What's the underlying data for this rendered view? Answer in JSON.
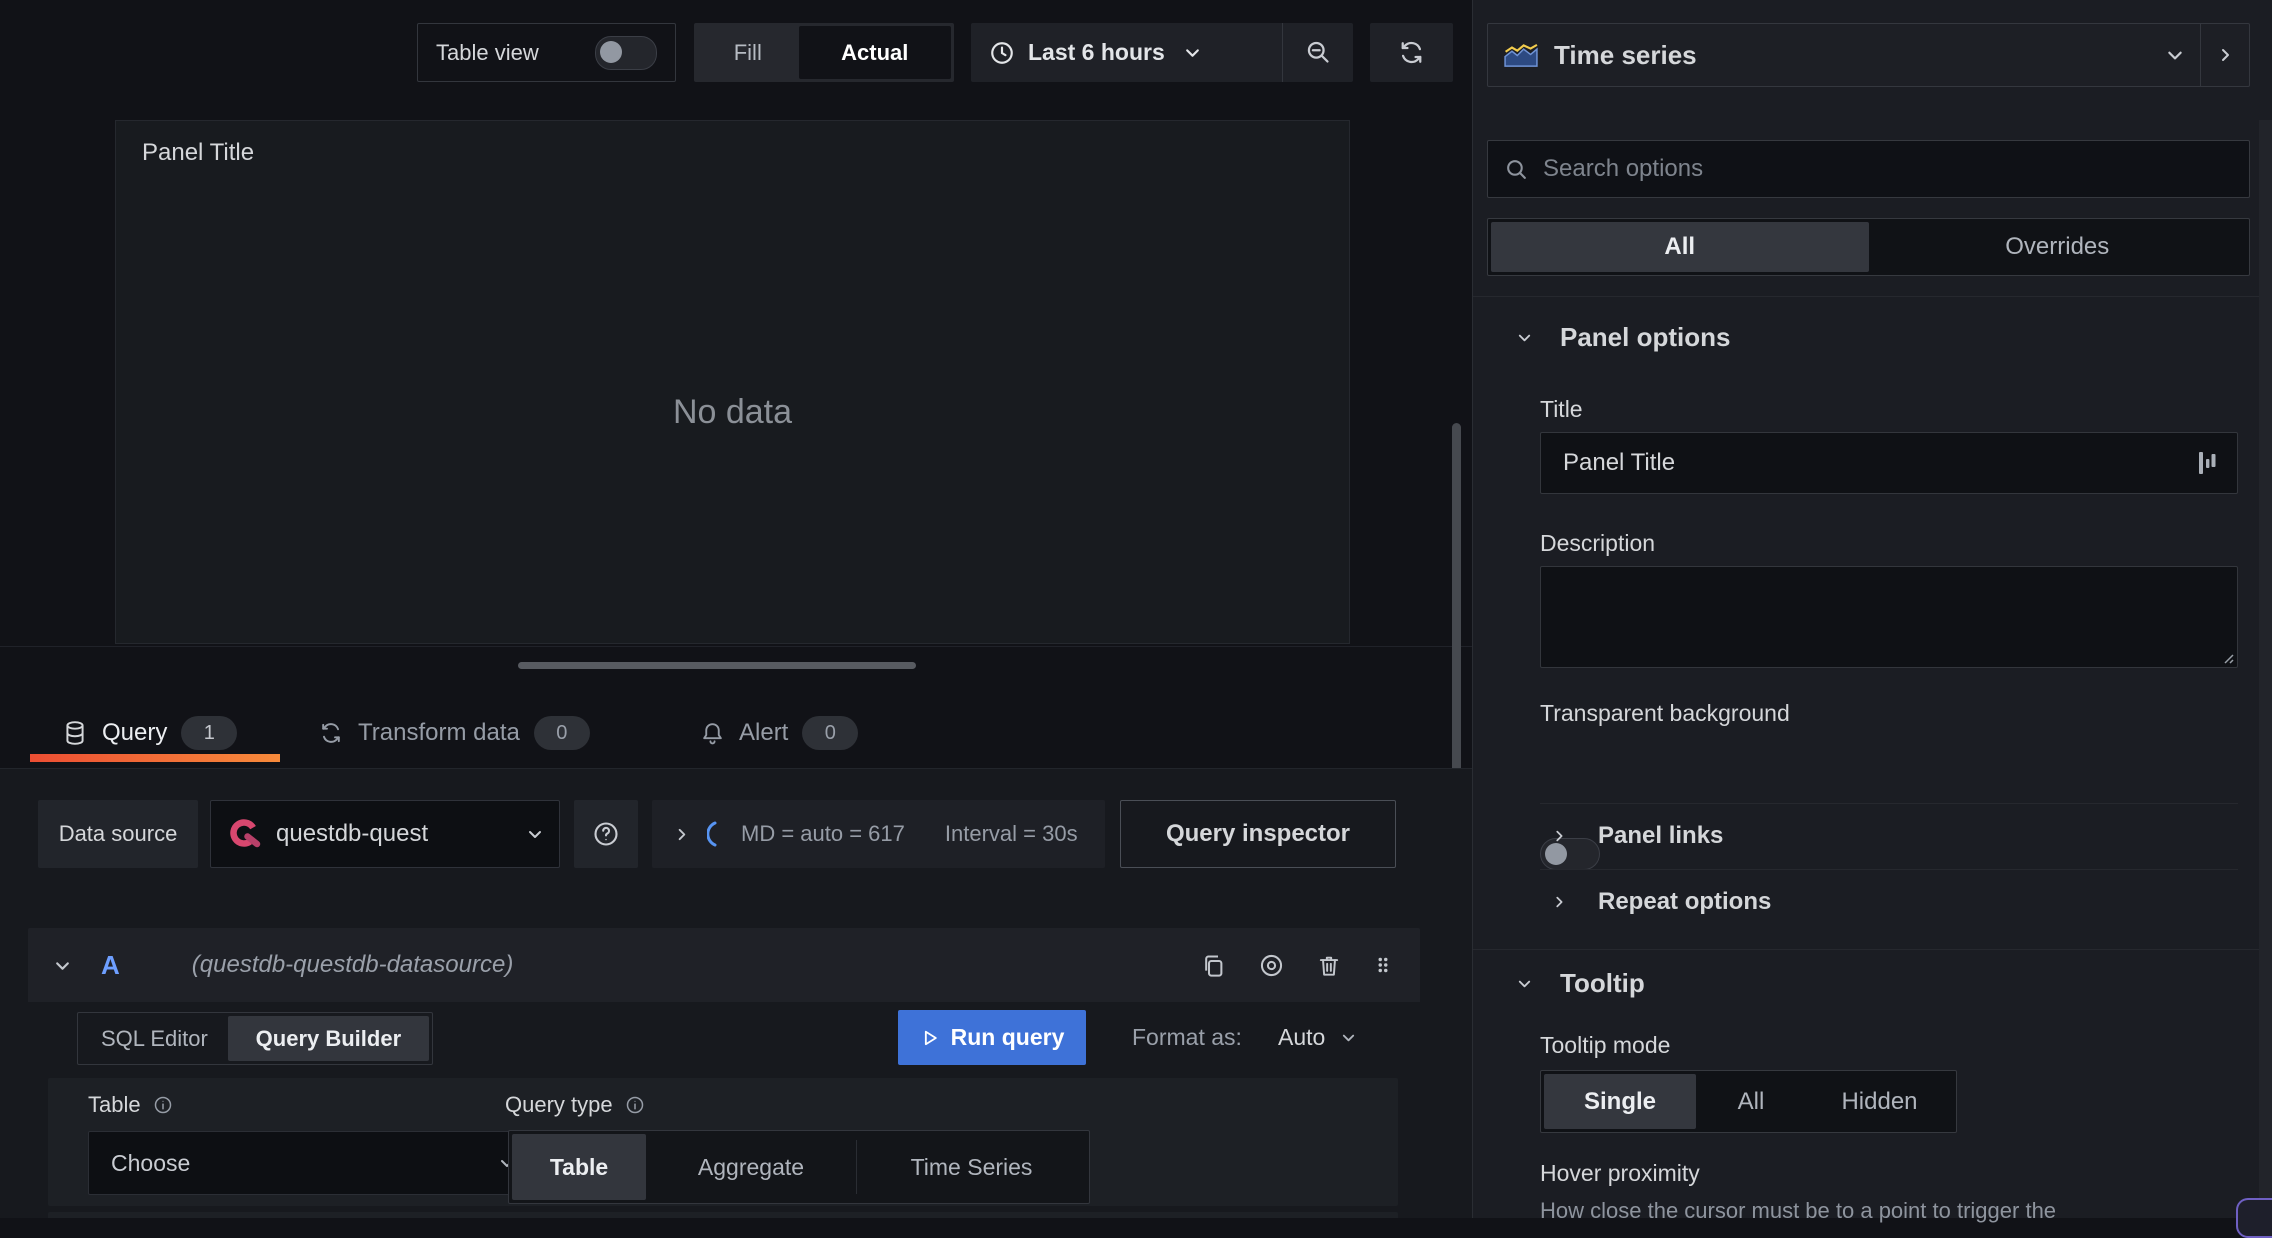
{
  "toolbar": {
    "table_view_label": "Table view",
    "fill_label": "Fill",
    "actual_label": "Actual",
    "time_range_label": "Last 6 hours"
  },
  "viz_picker": {
    "label": "Time series"
  },
  "options_pane": {
    "search_placeholder": "Search options",
    "filter_tabs": {
      "all": "All",
      "overrides": "Overrides"
    },
    "panel_options": {
      "heading": "Panel options",
      "title_label": "Title",
      "title_value": "Panel Title",
      "description_label": "Description",
      "transparent_bg_label": "Transparent background",
      "panel_links_label": "Panel links",
      "repeat_options_label": "Repeat options"
    },
    "tooltip": {
      "heading": "Tooltip",
      "mode_label": "Tooltip mode",
      "modes": [
        "Single",
        "All",
        "Hidden"
      ],
      "hover_proximity_label": "Hover proximity",
      "hover_proximity_desc": "How close the cursor must be to a point to trigger the"
    }
  },
  "panel": {
    "title": "Panel Title",
    "no_data": "No data"
  },
  "editor_tabs": [
    {
      "label": "Query",
      "count": "1"
    },
    {
      "label": "Transform data",
      "count": "0"
    },
    {
      "label": "Alert",
      "count": "0"
    }
  ],
  "datasource_row": {
    "label": "Data source",
    "name": "questdb-quest",
    "options_summary_md": "MD = auto = 617",
    "options_summary_interval": "Interval = 30s",
    "query_inspector_label": "Query inspector"
  },
  "query_row": {
    "ref_id": "A",
    "datasource_hint": "(questdb-questdb-datasource)"
  },
  "query_editor": {
    "editor_modes": [
      "SQL Editor",
      "Query Builder"
    ],
    "run_query_label": "Run query",
    "format_as_label": "Format as:",
    "format_value": "Auto",
    "table_label": "Table",
    "table_value": "Choose",
    "query_type_label": "Query type",
    "query_types": [
      "Table",
      "Aggregate",
      "Time Series"
    ]
  },
  "colors": {
    "accent_blue": "#3E72D8",
    "tab_active_orange_start": "#EC4E33",
    "tab_active_orange_end": "#F78A3B",
    "questdb_pink": "#D8476F",
    "ref_id_blue": "#6E9FFF",
    "spinner_blue": "#5794F2"
  },
  "icons": {
    "table_view_toggle": "toggle-off",
    "time_range": "clock",
    "zoom_out": "magnifier-minus",
    "refresh": "sync-arrows",
    "query_tab": "database-cylinder",
    "transform_tab": "cycle-arrows",
    "alert_tab": "bell",
    "datasource_logo": "questdb-q",
    "query_actions": [
      "copy",
      "eye",
      "trash",
      "drag-dots"
    ]
  }
}
